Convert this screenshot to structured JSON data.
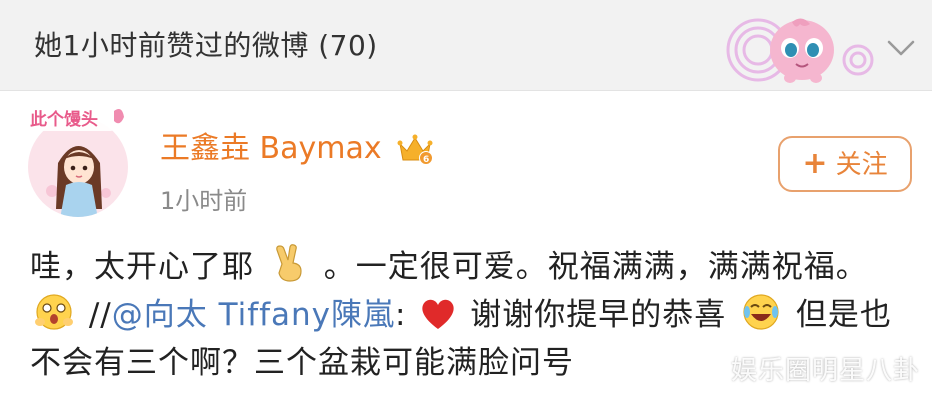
{
  "header": {
    "title": "她1小时前赞过的微博 (70)",
    "decoration_icon": "jigglypuff-sticker",
    "expand_icon": "chevron-down-icon"
  },
  "post": {
    "avatar_badge_text": "此个馒头",
    "username": "王鑫垚 Baymax",
    "vip_icon": "crown-badge-icon",
    "timestamp": "1小时前",
    "follow_button": {
      "label": "关注"
    },
    "content": {
      "part1": "哇，太开心了耶",
      "part2": "。一定很可爱。祝福满满，满满祝福。",
      "part3": "//",
      "mention": "@向太 Tiffany陳嵐",
      "part4": ":",
      "part5": "谢谢你提早的恭喜",
      "part6": "但是也不会有三个啊？三个盆栽可能满脸问号"
    }
  },
  "watermark": "娱乐圈明星八卦",
  "colors": {
    "header_bg": "#f2f2f2",
    "username": "#eb7a26",
    "mention": "#4a78b8",
    "follow_border": "#e8a16d",
    "heart": "#e02a2a"
  }
}
